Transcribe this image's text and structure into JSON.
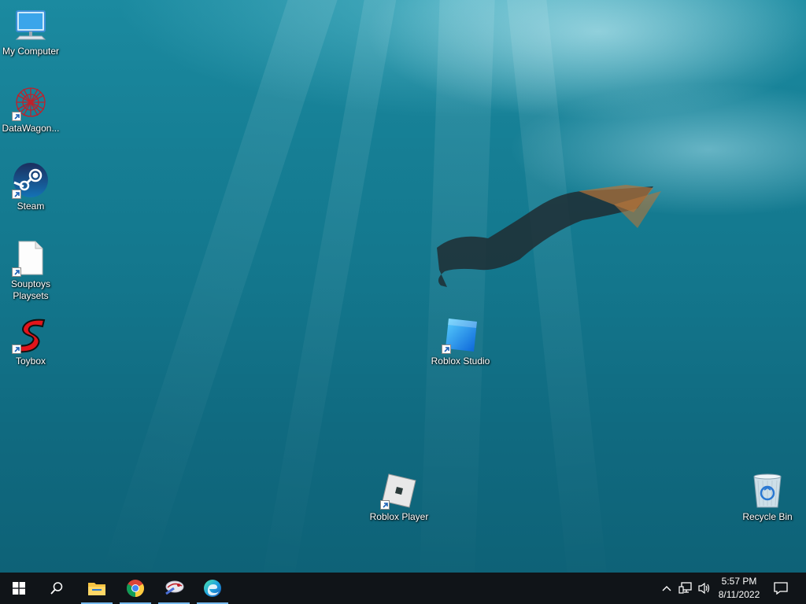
{
  "desktop": {
    "icons": [
      {
        "label": "My Computer",
        "icon": "monitor-icon",
        "shortcut": false
      },
      {
        "label": "DataWagon...",
        "icon": "datawagon-icon",
        "shortcut": true
      },
      {
        "label": "Steam",
        "icon": "steam-icon",
        "shortcut": true
      },
      {
        "label": "Souptoys Playsets",
        "icon": "blank-file-icon",
        "shortcut": true
      },
      {
        "label": "Toybox",
        "icon": "toybox-s-icon",
        "shortcut": true
      },
      {
        "label": "Roblox Studio",
        "icon": "roblox-studio-icon",
        "shortcut": true
      },
      {
        "label": "Roblox Player",
        "icon": "roblox-player-icon",
        "shortcut": true
      },
      {
        "label": "Recycle Bin",
        "icon": "recycle-bin-icon",
        "shortcut": false
      }
    ]
  },
  "taskbar": {
    "buttons": [
      {
        "icon": "windows-start-icon",
        "active": false
      },
      {
        "icon": "search-icon",
        "active": false
      },
      {
        "icon": "file-explorer-icon",
        "active": true
      },
      {
        "icon": "chrome-icon",
        "active": true
      },
      {
        "icon": "datawagon-taskbar-icon",
        "active": true
      },
      {
        "icon": "edge-icon",
        "active": true
      }
    ],
    "tray": {
      "icons": [
        "chevron-up-icon",
        "network-icon",
        "volume-icon",
        "notification-icon"
      ],
      "time": "5:57 PM",
      "date": "8/11/2022"
    }
  }
}
